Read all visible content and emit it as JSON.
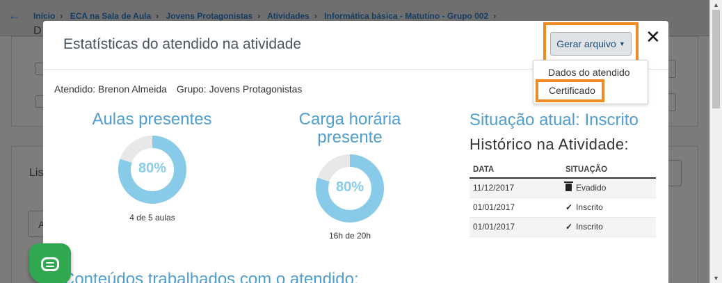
{
  "breadcrumb": [
    "Início",
    "ECA na Sala de Aula",
    "Jovens Protagonistas",
    "Atividades",
    "Informática básica - Matutino - Grupo 002"
  ],
  "background": {
    "card1_fragment": "D",
    "card2_fragment": "Lis",
    "card3_fragment": "A"
  },
  "modal": {
    "title": "Estatísticas do atendido na atividade",
    "gerar_label": "Gerar arquivo",
    "close_label": "✕",
    "dropdown": {
      "item1": "Dados do atendido",
      "item2": "Certificado"
    },
    "atendido": "Atendido: Brenon Almeida",
    "grupo": "Grupo: Jovens Protagonistas",
    "aulas": {
      "title": "Aulas presentes",
      "percent_label": "80%",
      "percent": 80,
      "caption": "4 de 5 aulas"
    },
    "carga": {
      "title_line1": "Carga horária",
      "title_line2": "presente",
      "percent_label": "80%",
      "percent": 80,
      "caption": "16h de 20h"
    },
    "situacao": "Situação atual: Inscrito",
    "historico_title": "Histórico na Atividade:",
    "historico": {
      "headers": [
        "DATA",
        "SITUAÇÃO"
      ],
      "rows": [
        {
          "data": "11/12/2017",
          "situacao": "Evadido",
          "icon": "trash-icon"
        },
        {
          "data": "01/01/2017",
          "situacao": "Inscrito",
          "icon": "check-icon"
        },
        {
          "data": "01/01/2017",
          "situacao": "Inscrito",
          "icon": "check-icon"
        }
      ]
    },
    "conteudos_title": "Conteúdos trabalhados com o atendido:"
  },
  "colors": {
    "accent": "#4f9ecf",
    "donut_fill": "#87cbe8",
    "donut_track": "#e8e8e8",
    "highlight": "#f08a24",
    "chat": "#2fa84f"
  }
}
